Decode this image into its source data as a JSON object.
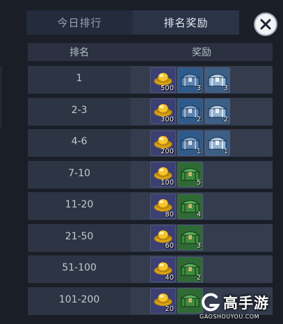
{
  "tabs": [
    {
      "label": "今日排行",
      "active": false
    },
    {
      "label": "排名奖励",
      "active": true
    }
  ],
  "close_icon": "close-x-icon",
  "table": {
    "headers": {
      "rank": "排名",
      "reward": "奖励"
    },
    "rows": [
      {
        "rank": "1",
        "items": [
          {
            "type": "gold",
            "icon": "gold-ingot-icon",
            "count": "500"
          },
          {
            "type": "blue",
            "icon": "blue-chest-icon",
            "count": "3"
          },
          {
            "type": "silver",
            "icon": "silver-chest-icon",
            "count": "3"
          }
        ]
      },
      {
        "rank": "2-3",
        "items": [
          {
            "type": "gold",
            "icon": "gold-ingot-icon",
            "count": "300"
          },
          {
            "type": "blue",
            "icon": "blue-chest-icon",
            "count": "2"
          },
          {
            "type": "silver",
            "icon": "silver-chest-icon",
            "count": "2"
          }
        ]
      },
      {
        "rank": "4-6",
        "items": [
          {
            "type": "gold",
            "icon": "gold-ingot-icon",
            "count": "200"
          },
          {
            "type": "blue",
            "icon": "blue-chest-icon",
            "count": "1"
          },
          {
            "type": "silver",
            "icon": "silver-chest-icon",
            "count": "1"
          }
        ]
      },
      {
        "rank": "7-10",
        "items": [
          {
            "type": "gold",
            "icon": "gold-ingot-icon",
            "count": "100"
          },
          {
            "type": "green",
            "icon": "green-chest-icon",
            "count": "5"
          }
        ]
      },
      {
        "rank": "11-20",
        "items": [
          {
            "type": "gold",
            "icon": "gold-ingot-icon",
            "count": "80"
          },
          {
            "type": "green",
            "icon": "green-chest-icon",
            "count": "4"
          }
        ]
      },
      {
        "rank": "21-50",
        "items": [
          {
            "type": "gold",
            "icon": "gold-ingot-icon",
            "count": "60"
          },
          {
            "type": "green",
            "icon": "green-chest-icon",
            "count": "3"
          }
        ]
      },
      {
        "rank": "51-100",
        "items": [
          {
            "type": "gold",
            "icon": "gold-ingot-icon",
            "count": "40"
          },
          {
            "type": "green",
            "icon": "green-chest-icon",
            "count": "2"
          }
        ]
      },
      {
        "rank": "101-200",
        "items": [
          {
            "type": "gold",
            "icon": "gold-ingot-icon",
            "count": "20"
          },
          {
            "type": "green",
            "icon": "green-chest-icon",
            "count": ""
          }
        ]
      }
    ]
  },
  "watermark": {
    "name": "高手游",
    "url": "GAOSHOUYOU.COM"
  },
  "colors": {
    "background": "#1a1e27",
    "tab_bar": "#232b3d",
    "row": "#2d3444",
    "gold": "#e8b51e"
  }
}
